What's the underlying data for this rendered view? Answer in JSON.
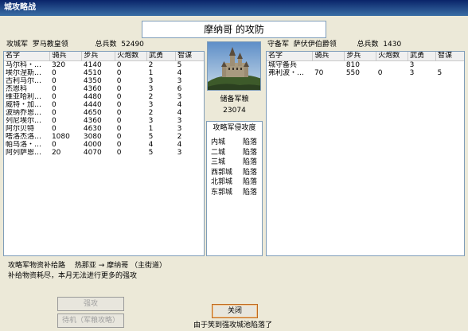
{
  "window": {
    "title": "城攻略战"
  },
  "banner": {
    "title": "摩纳哥 的攻防"
  },
  "attacker": {
    "label": "攻城军",
    "commander": "罗马教皇领",
    "total_label": "总兵数",
    "total": "52490",
    "columns": [
      "名字",
      "骑兵",
      "步兵",
      "火炮数",
      "武勇",
      "智谋"
    ],
    "rows": [
      [
        "马尔科・…",
        "320",
        "4140",
        "0",
        "2",
        "5"
      ],
      [
        "埃尔涅斯…",
        "0",
        "4510",
        "0",
        "1",
        "4"
      ],
      [
        "古利马尔…",
        "0",
        "4350",
        "0",
        "3",
        "3"
      ],
      [
        "杰恩科",
        "0",
        "4360",
        "0",
        "3",
        "6"
      ],
      [
        "维亚哈利…",
        "0",
        "4480",
        "0",
        "2",
        "3"
      ],
      [
        "威特・加…",
        "0",
        "4440",
        "0",
        "3",
        "4"
      ],
      [
        "波纳乔恩…",
        "0",
        "4650",
        "0",
        "2",
        "4"
      ],
      [
        "列尼埃尔…",
        "0",
        "4360",
        "0",
        "3",
        "3"
      ],
      [
        "阿尔贝特",
        "0",
        "4630",
        "0",
        "1",
        "3"
      ],
      [
        "嗒洛杰洛…",
        "1080",
        "3080",
        "0",
        "5",
        "2"
      ],
      [
        "帕乌洛・…",
        "0",
        "4000",
        "0",
        "4",
        "4"
      ],
      [
        "阿列萨恩…",
        "20",
        "4070",
        "0",
        "5",
        "3"
      ]
    ]
  },
  "defender": {
    "label": "守备军",
    "commander": "萨伏伊伯爵领",
    "total_label": "总兵数",
    "total": "1430",
    "columns": [
      "名字",
      "骑兵",
      "步兵",
      "火炮数",
      "武勇",
      "智谋"
    ],
    "rows": [
      [
        "城守备兵",
        "",
        "810",
        "",
        "3",
        ""
      ],
      [
        "弗利波・…",
        "70",
        "550",
        "0",
        "3",
        "5"
      ]
    ]
  },
  "center": {
    "reserve_label": "储备军粮",
    "reserve_value": "23074",
    "status_title": "攻略军侵攻度",
    "zones": [
      {
        "name": "内城",
        "state": "陷落"
      },
      {
        "name": "二城",
        "state": "陷落"
      },
      {
        "name": "三城",
        "state": "陷落"
      },
      {
        "name": "西郭城",
        "state": "陷落"
      },
      {
        "name": "北郭城",
        "state": "陷落"
      },
      {
        "name": "东郭城",
        "state": "陷落"
      }
    ]
  },
  "info": {
    "line1": "攻略军物资补给路　 热那亚 → 摩纳哥 （主街道）",
    "line2": "补给物资耗尽，本月无法进行更多的强攻"
  },
  "buttons": {
    "assault": "强攻",
    "standby": "待机（军粮攻略）",
    "close": "关闭"
  },
  "footer": {
    "message": "由于笑到强攻城池陷落了"
  }
}
